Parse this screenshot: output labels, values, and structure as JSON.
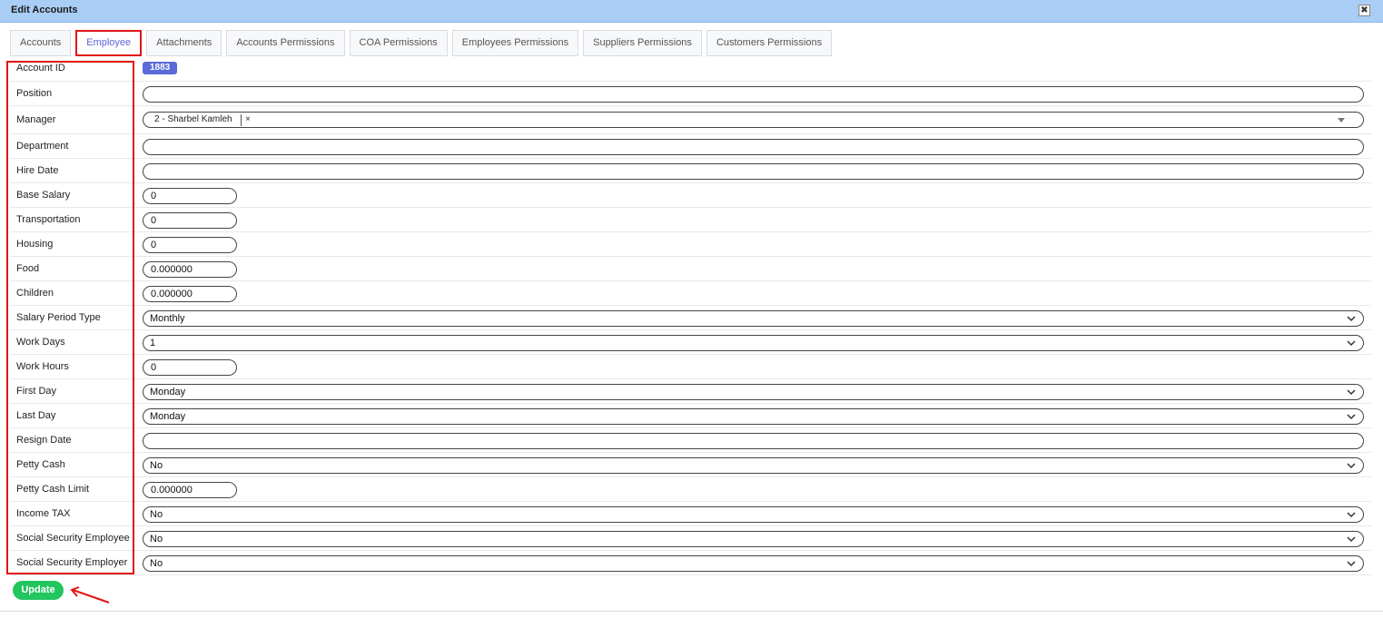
{
  "window": {
    "title": "Edit Accounts",
    "close_label": "✖"
  },
  "tabs": [
    {
      "label": "Accounts",
      "active": false
    },
    {
      "label": "Employee",
      "active": true
    },
    {
      "label": "Attachments",
      "active": false
    },
    {
      "label": "Accounts Permissions",
      "active": false
    },
    {
      "label": "COA Permissions",
      "active": false
    },
    {
      "label": "Employees Permissions",
      "active": false
    },
    {
      "label": "Suppliers Permissions",
      "active": false
    },
    {
      "label": "Customers Permissions",
      "active": false
    }
  ],
  "form": {
    "account_id": {
      "label": "Account ID",
      "value": "1883"
    },
    "position": {
      "label": "Position",
      "value": ""
    },
    "manager": {
      "label": "Manager",
      "tag": "2 - Sharbel Kamleh",
      "remove": "×"
    },
    "department": {
      "label": "Department",
      "value": ""
    },
    "hire_date": {
      "label": "Hire Date",
      "value": ""
    },
    "base_salary": {
      "label": "Base Salary",
      "value": "0"
    },
    "transportation": {
      "label": "Transportation",
      "value": "0"
    },
    "housing": {
      "label": "Housing",
      "value": "0"
    },
    "food": {
      "label": "Food",
      "value": "0.000000"
    },
    "children": {
      "label": "Children",
      "value": "0.000000"
    },
    "salary_period_type": {
      "label": "Salary Period Type",
      "value": "Monthly"
    },
    "work_days": {
      "label": "Work Days",
      "value": "1"
    },
    "work_hours": {
      "label": "Work Hours",
      "value": "0"
    },
    "first_day": {
      "label": "First Day",
      "value": "Monday"
    },
    "last_day": {
      "label": "Last Day",
      "value": "Monday"
    },
    "resign_date": {
      "label": "Resign Date",
      "value": ""
    },
    "petty_cash": {
      "label": "Petty Cash",
      "value": "No"
    },
    "petty_cash_limit": {
      "label": "Petty Cash Limit",
      "value": "0.000000"
    },
    "income_tax": {
      "label": "Income TAX",
      "value": "No"
    },
    "social_security_employee": {
      "label": "Social Security Employee",
      "value": "No"
    },
    "social_security_employer": {
      "label": "Social Security Employer",
      "value": "No"
    }
  },
  "actions": {
    "update_label": "Update"
  },
  "colors": {
    "accent": "#5b6bd9",
    "success": "#22c55e",
    "highlight": "#e01515",
    "titlebar": "#a9cdf5"
  }
}
